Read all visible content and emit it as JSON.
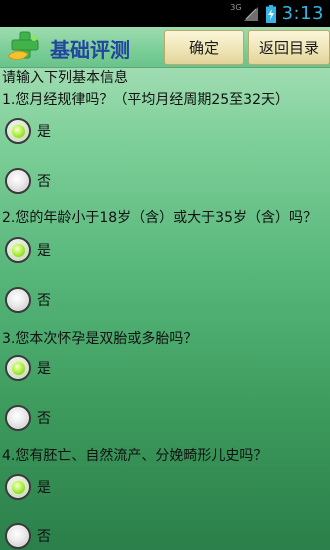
{
  "status_bar": {
    "network": "3G",
    "time": "3:13"
  },
  "header": {
    "title": "基础评测",
    "confirm_label": "确定",
    "back_label": "返回目录"
  },
  "content": {
    "intro": "请输入下列基本信息",
    "questions": [
      {
        "text": "1.您月经规律吗？（平均月经周期25至32天）",
        "options": [
          "是",
          "否"
        ],
        "selected": "是"
      },
      {
        "text": "2.您的年龄小于18岁（含）或大于35岁（含）吗？",
        "options": [
          "是",
          "否"
        ],
        "selected": "是"
      },
      {
        "text": "3.您本次怀孕是双胎或多胎吗？",
        "options": [
          "是",
          "否"
        ],
        "selected": "是"
      },
      {
        "text": "4.您有胚亡、自然流产、分娩畸形儿史吗？",
        "options": [
          "是",
          "否"
        ],
        "selected": "是"
      }
    ]
  },
  "colors": {
    "accent": "#34b5e5",
    "title": "#23459d",
    "radio_checked": "#9be83c"
  },
  "icons": {
    "app": "green-cross-logo-icon",
    "signal": "signal-icon",
    "battery": "battery-charging-icon"
  }
}
